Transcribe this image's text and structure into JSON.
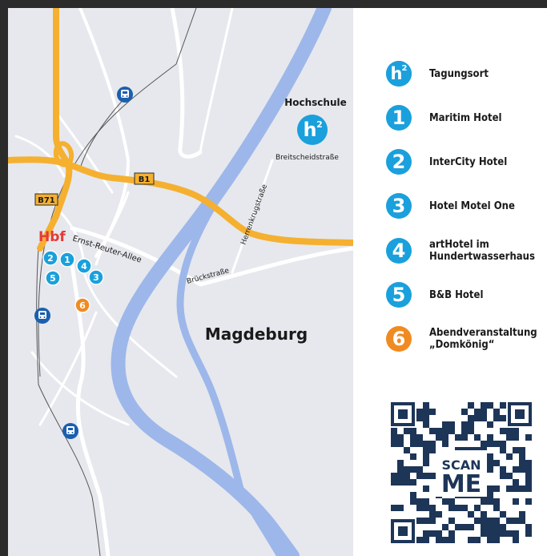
{
  "colors": {
    "accent_blue": "#1aa0dc",
    "accent_orange": "#f08b22",
    "road_orange": "#f5b030",
    "river_blue": "#9db7ea",
    "hbf_red": "#e53935",
    "map_bg": "#e6e8ed"
  },
  "map": {
    "city_label": "Magdeburg",
    "hbf_label": "Hbf",
    "hochschule_label": "Hochschule",
    "road_labels": {
      "b1": "B1",
      "b71": "B71",
      "ernst_reuter_allee": "Ernst-Reuter-Allee",
      "brueckstrasse": "Brückstraße",
      "herrenkrugstrasse": "Herrenkrugstraße",
      "breitscheidstrasse": "Breitscheidstraße"
    },
    "hotel_markers": [
      "1",
      "2",
      "3",
      "4",
      "5",
      "6"
    ],
    "logo_text": "h",
    "logo_superscript": "2",
    "train_icon": "train-station-icon"
  },
  "legend": [
    {
      "badge": "h²",
      "label": "Tagungsort",
      "color": "#1aa0dc"
    },
    {
      "badge": "1",
      "label": "Maritim Hotel",
      "color": "#1aa0dc"
    },
    {
      "badge": "2",
      "label": "InterCity Hotel",
      "color": "#1aa0dc"
    },
    {
      "badge": "3",
      "label": "Hotel Motel One",
      "color": "#1aa0dc"
    },
    {
      "badge": "4",
      "label": "artHotel im\nHundertwasserhaus",
      "color": "#1aa0dc"
    },
    {
      "badge": "5",
      "label": "B&B Hotel",
      "color": "#1aa0dc"
    },
    {
      "badge": "6",
      "label": "Abendveranstaltung\n„Domkönig“",
      "color": "#f08b22"
    }
  ],
  "qr": {
    "line1": "SCAN",
    "line2": "ME"
  }
}
